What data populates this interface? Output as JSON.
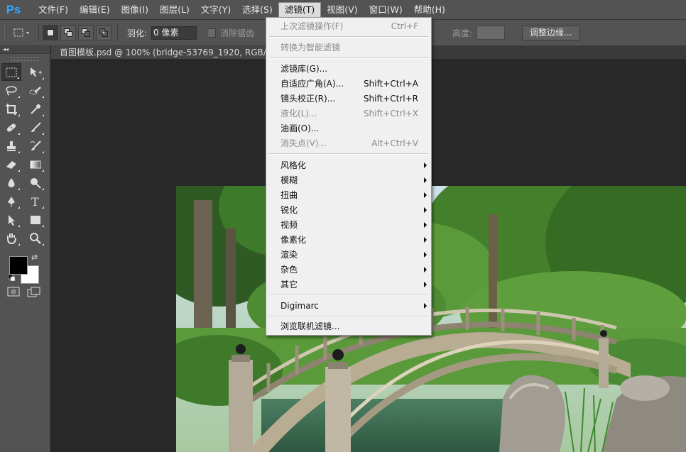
{
  "app": {
    "logo": "Ps"
  },
  "menubar": {
    "items": [
      "文件(F)",
      "编辑(E)",
      "图像(I)",
      "图层(L)",
      "文字(Y)",
      "选择(S)",
      "滤镜(T)",
      "视图(V)",
      "窗口(W)",
      "帮助(H)"
    ],
    "active": "滤镜(T)"
  },
  "options": {
    "feather_label": "羽化:",
    "feather_value": "0 像素",
    "antialias_label": "消除锯齿",
    "height_label": "高度:",
    "refine_label": "调整边缘..."
  },
  "document": {
    "tab_title": "首图模板.psd @ 100% (bridge-53769_1920, RGB/8#)"
  },
  "toolbox": {
    "collapse": "◂◂",
    "tools": [
      "rect-marquee-icon",
      "move-icon",
      "lasso-icon",
      "quick-select-icon",
      "crop-icon",
      "eyedropper-icon",
      "healing-brush-icon",
      "brush-icon",
      "clone-stamp-icon",
      "history-brush-icon",
      "eraser-icon",
      "gradient-icon",
      "blur-icon",
      "dodge-icon",
      "pen-icon",
      "type-icon",
      "path-select-icon",
      "rectangle-icon",
      "hand-icon",
      "zoom-icon"
    ],
    "fg_color": "#000000",
    "bg_color": "#ffffff"
  },
  "filter_menu": {
    "last_filter": {
      "label": "上次滤镜操作(F)",
      "shortcut": "Ctrl+F",
      "disabled": true
    },
    "convert_smart": {
      "label": "转换为智能滤镜",
      "disabled": true
    },
    "gallery": {
      "label": "滤镜库(G)..."
    },
    "adaptive_wide": {
      "label": "自适应广角(A)...",
      "shortcut": "Shift+Ctrl+A"
    },
    "lens_correction": {
      "label": "镜头校正(R)...",
      "shortcut": "Shift+Ctrl+R"
    },
    "liquify": {
      "label": "液化(L)...",
      "shortcut": "Shift+Ctrl+X",
      "disabled": true
    },
    "oil_paint": {
      "label": "油画(O)..."
    },
    "vanishing_point": {
      "label": "消失点(V)...",
      "shortcut": "Alt+Ctrl+V",
      "disabled": true
    },
    "submenus": [
      "风格化",
      "模糊",
      "扭曲",
      "锐化",
      "视频",
      "像素化",
      "渲染",
      "杂色",
      "其它"
    ],
    "digimarc": "Digimarc",
    "browse_online": "浏览联机滤镜..."
  }
}
